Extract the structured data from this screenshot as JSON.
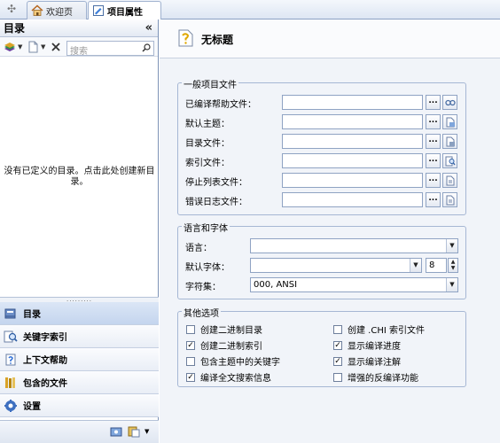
{
  "tabs": [
    {
      "label": "欢迎页",
      "icon": "home-icon"
    },
    {
      "label": "项目属性",
      "icon": "properties-icon"
    }
  ],
  "sidebar": {
    "title": "目录",
    "search_placeholder": "搜索",
    "empty_message": "没有已定义的目录。点击此处创建新目录。",
    "nav_items": [
      {
        "label": "目录",
        "icon": "book-icon"
      },
      {
        "label": "关键字索引",
        "icon": "index-icon"
      },
      {
        "label": "上下文帮助",
        "icon": "context-help-icon"
      },
      {
        "label": "包含的文件",
        "icon": "files-icon"
      },
      {
        "label": "设置",
        "icon": "settings-icon"
      }
    ]
  },
  "main": {
    "page_title": "无标题",
    "general": {
      "legend": "一般项目文件",
      "rows": [
        {
          "label": "已编译帮助文件：",
          "value": ""
        },
        {
          "label": "默认主题：",
          "value": ""
        },
        {
          "label": "目录文件：",
          "value": ""
        },
        {
          "label": "索引文件：",
          "value": ""
        },
        {
          "label": "停止列表文件：",
          "value": ""
        },
        {
          "label": "错误日志文件：",
          "value": ""
        }
      ],
      "browse_label": "..."
    },
    "language": {
      "legend": "语言和字体",
      "language_label": "语言：",
      "language_value": "",
      "font_label": "默认字体：",
      "font_value": "",
      "font_size": "8",
      "charset_label": "字符集：",
      "charset_value": "000, ANSI"
    },
    "other": {
      "legend": "其他选项",
      "options": [
        {
          "label": "创建二进制目录",
          "checked": false
        },
        {
          "label": "创建 .CHI 索引文件",
          "checked": false
        },
        {
          "label": "创建二进制索引",
          "checked": true
        },
        {
          "label": "显示编译进度",
          "checked": true
        },
        {
          "label": "包含主题中的关键字",
          "checked": false
        },
        {
          "label": "显示编译注解",
          "checked": true
        },
        {
          "label": "编译全文搜索信息",
          "checked": true
        },
        {
          "label": "增强的反编译功能",
          "checked": false
        }
      ]
    }
  }
}
